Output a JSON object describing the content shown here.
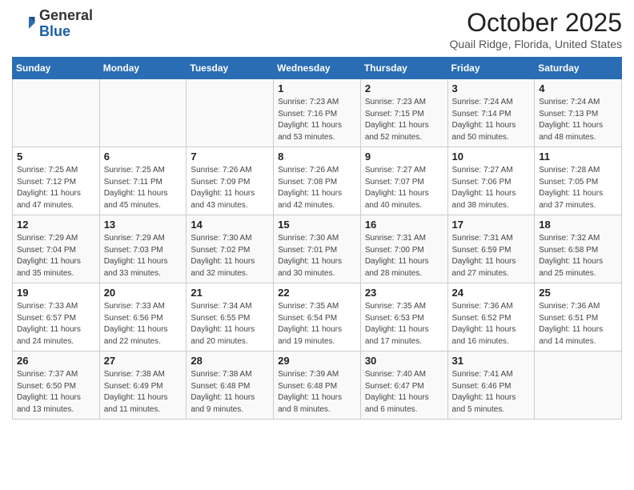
{
  "header": {
    "logo_line1": "General",
    "logo_line2": "Blue",
    "month": "October 2025",
    "location": "Quail Ridge, Florida, United States"
  },
  "days_of_week": [
    "Sunday",
    "Monday",
    "Tuesday",
    "Wednesday",
    "Thursday",
    "Friday",
    "Saturday"
  ],
  "weeks": [
    [
      {
        "day": "",
        "info": ""
      },
      {
        "day": "",
        "info": ""
      },
      {
        "day": "",
        "info": ""
      },
      {
        "day": "1",
        "info": "Sunrise: 7:23 AM\nSunset: 7:16 PM\nDaylight: 11 hours and 53 minutes."
      },
      {
        "day": "2",
        "info": "Sunrise: 7:23 AM\nSunset: 7:15 PM\nDaylight: 11 hours and 52 minutes."
      },
      {
        "day": "3",
        "info": "Sunrise: 7:24 AM\nSunset: 7:14 PM\nDaylight: 11 hours and 50 minutes."
      },
      {
        "day": "4",
        "info": "Sunrise: 7:24 AM\nSunset: 7:13 PM\nDaylight: 11 hours and 48 minutes."
      }
    ],
    [
      {
        "day": "5",
        "info": "Sunrise: 7:25 AM\nSunset: 7:12 PM\nDaylight: 11 hours and 47 minutes."
      },
      {
        "day": "6",
        "info": "Sunrise: 7:25 AM\nSunset: 7:11 PM\nDaylight: 11 hours and 45 minutes."
      },
      {
        "day": "7",
        "info": "Sunrise: 7:26 AM\nSunset: 7:09 PM\nDaylight: 11 hours and 43 minutes."
      },
      {
        "day": "8",
        "info": "Sunrise: 7:26 AM\nSunset: 7:08 PM\nDaylight: 11 hours and 42 minutes."
      },
      {
        "day": "9",
        "info": "Sunrise: 7:27 AM\nSunset: 7:07 PM\nDaylight: 11 hours and 40 minutes."
      },
      {
        "day": "10",
        "info": "Sunrise: 7:27 AM\nSunset: 7:06 PM\nDaylight: 11 hours and 38 minutes."
      },
      {
        "day": "11",
        "info": "Sunrise: 7:28 AM\nSunset: 7:05 PM\nDaylight: 11 hours and 37 minutes."
      }
    ],
    [
      {
        "day": "12",
        "info": "Sunrise: 7:29 AM\nSunset: 7:04 PM\nDaylight: 11 hours and 35 minutes."
      },
      {
        "day": "13",
        "info": "Sunrise: 7:29 AM\nSunset: 7:03 PM\nDaylight: 11 hours and 33 minutes."
      },
      {
        "day": "14",
        "info": "Sunrise: 7:30 AM\nSunset: 7:02 PM\nDaylight: 11 hours and 32 minutes."
      },
      {
        "day": "15",
        "info": "Sunrise: 7:30 AM\nSunset: 7:01 PM\nDaylight: 11 hours and 30 minutes."
      },
      {
        "day": "16",
        "info": "Sunrise: 7:31 AM\nSunset: 7:00 PM\nDaylight: 11 hours and 28 minutes."
      },
      {
        "day": "17",
        "info": "Sunrise: 7:31 AM\nSunset: 6:59 PM\nDaylight: 11 hours and 27 minutes."
      },
      {
        "day": "18",
        "info": "Sunrise: 7:32 AM\nSunset: 6:58 PM\nDaylight: 11 hours and 25 minutes."
      }
    ],
    [
      {
        "day": "19",
        "info": "Sunrise: 7:33 AM\nSunset: 6:57 PM\nDaylight: 11 hours and 24 minutes."
      },
      {
        "day": "20",
        "info": "Sunrise: 7:33 AM\nSunset: 6:56 PM\nDaylight: 11 hours and 22 minutes."
      },
      {
        "day": "21",
        "info": "Sunrise: 7:34 AM\nSunset: 6:55 PM\nDaylight: 11 hours and 20 minutes."
      },
      {
        "day": "22",
        "info": "Sunrise: 7:35 AM\nSunset: 6:54 PM\nDaylight: 11 hours and 19 minutes."
      },
      {
        "day": "23",
        "info": "Sunrise: 7:35 AM\nSunset: 6:53 PM\nDaylight: 11 hours and 17 minutes."
      },
      {
        "day": "24",
        "info": "Sunrise: 7:36 AM\nSunset: 6:52 PM\nDaylight: 11 hours and 16 minutes."
      },
      {
        "day": "25",
        "info": "Sunrise: 7:36 AM\nSunset: 6:51 PM\nDaylight: 11 hours and 14 minutes."
      }
    ],
    [
      {
        "day": "26",
        "info": "Sunrise: 7:37 AM\nSunset: 6:50 PM\nDaylight: 11 hours and 13 minutes."
      },
      {
        "day": "27",
        "info": "Sunrise: 7:38 AM\nSunset: 6:49 PM\nDaylight: 11 hours and 11 minutes."
      },
      {
        "day": "28",
        "info": "Sunrise: 7:38 AM\nSunset: 6:48 PM\nDaylight: 11 hours and 9 minutes."
      },
      {
        "day": "29",
        "info": "Sunrise: 7:39 AM\nSunset: 6:48 PM\nDaylight: 11 hours and 8 minutes."
      },
      {
        "day": "30",
        "info": "Sunrise: 7:40 AM\nSunset: 6:47 PM\nDaylight: 11 hours and 6 minutes."
      },
      {
        "day": "31",
        "info": "Sunrise: 7:41 AM\nSunset: 6:46 PM\nDaylight: 11 hours and 5 minutes."
      },
      {
        "day": "",
        "info": ""
      }
    ]
  ]
}
